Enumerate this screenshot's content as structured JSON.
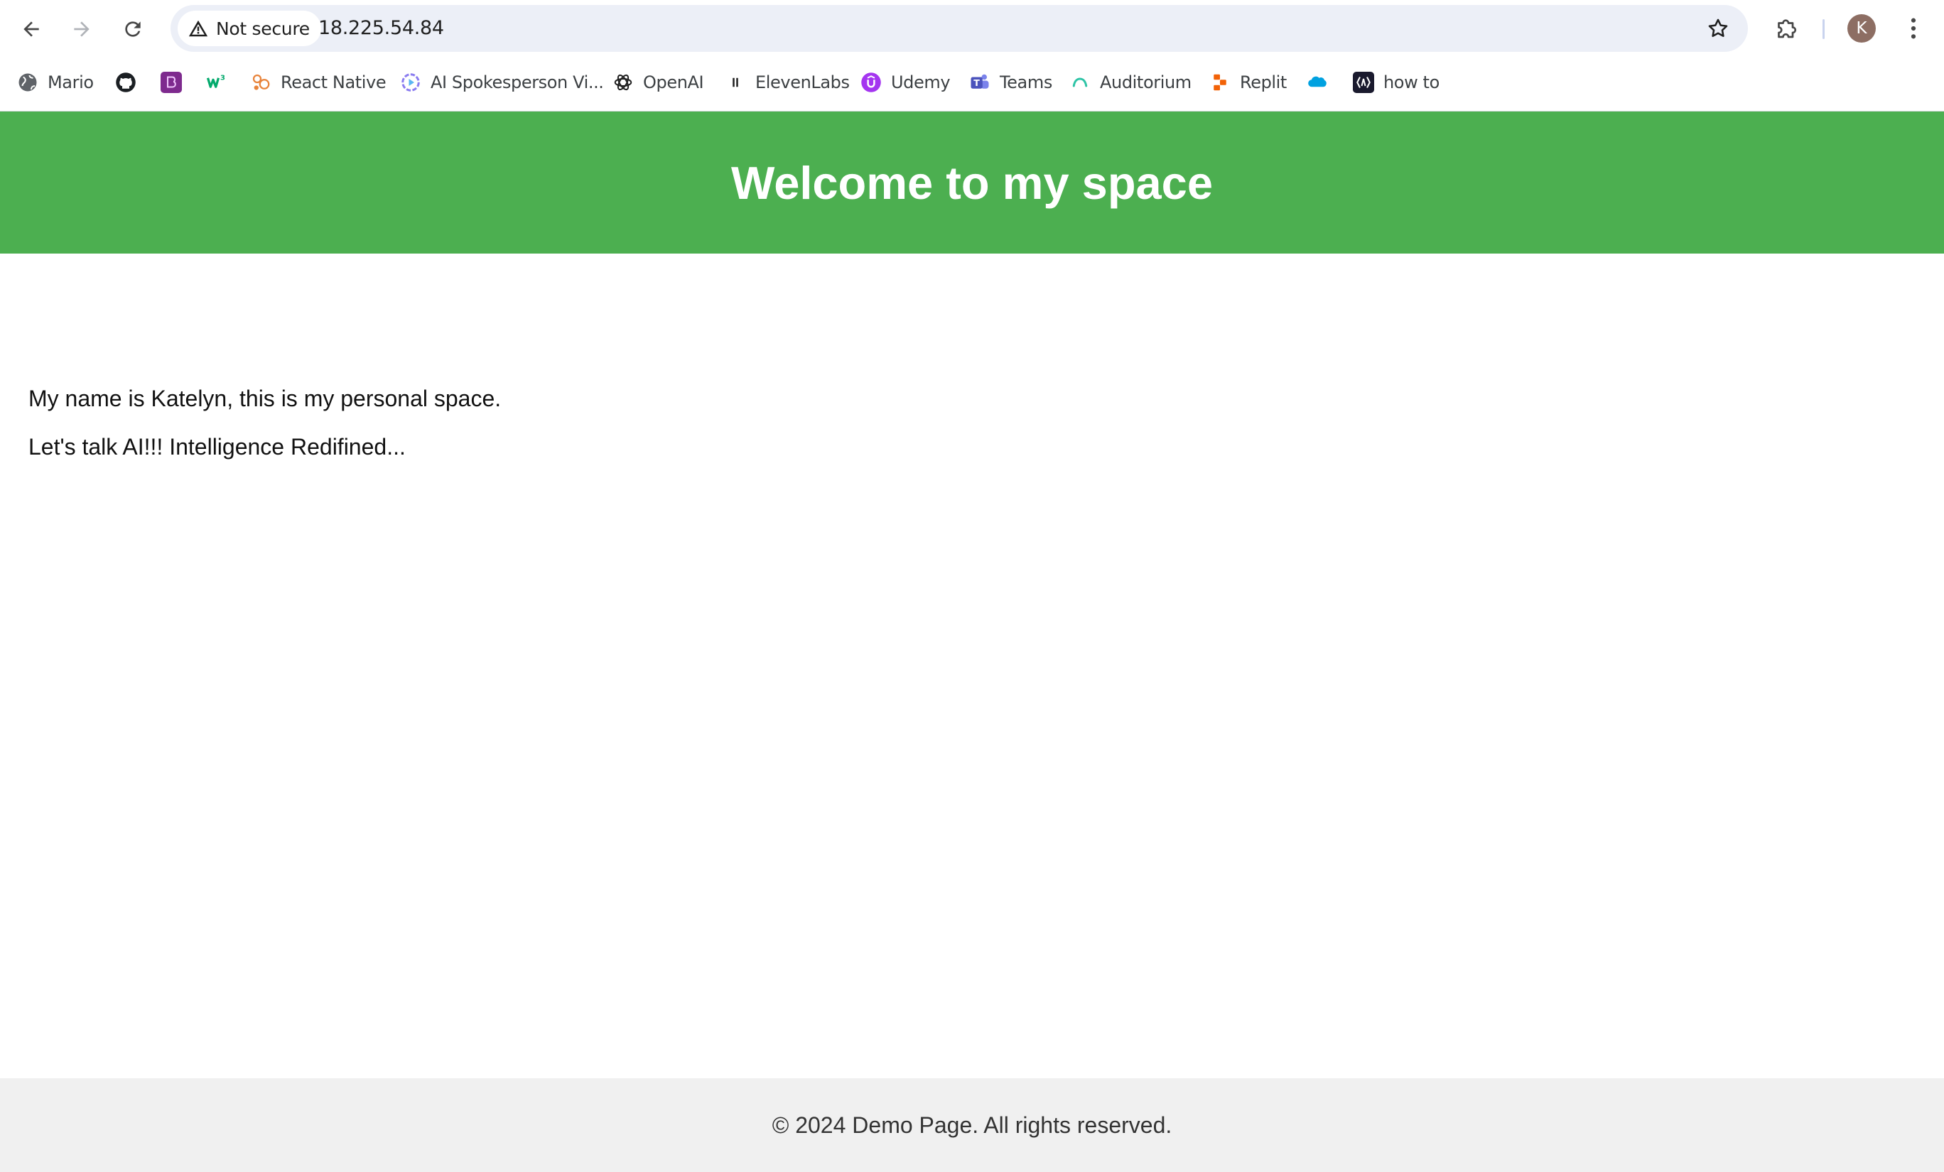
{
  "browser": {
    "security_label": "Not secure",
    "url": "18.225.54.84",
    "profile_initial": "K",
    "icons": {
      "back": "arrow-left-icon",
      "forward": "arrow-right-icon",
      "reload": "reload-icon",
      "security": "warning-triangle-icon",
      "bookmark": "star-icon",
      "extensions": "puzzle-icon",
      "menu": "kebab-menu-icon"
    }
  },
  "bookmarks": [
    {
      "label": "Mario",
      "icon": "globe-icon"
    },
    {
      "label": "",
      "icon": "github-icon"
    },
    {
      "label": "",
      "icon": "bootstrap-icon"
    },
    {
      "label": "",
      "icon": "w3schools-icon"
    },
    {
      "label": "React Native",
      "icon": "react-native-icon"
    },
    {
      "label": "AI Spokesperson Vi...",
      "icon": "ai-spokesperson-icon"
    },
    {
      "label": "OpenAI",
      "icon": "openai-icon"
    },
    {
      "label": "ElevenLabs",
      "icon": "elevenlabs-icon"
    },
    {
      "label": "Udemy",
      "icon": "udemy-icon"
    },
    {
      "label": "Teams",
      "icon": "teams-icon"
    },
    {
      "label": "Auditorium",
      "icon": "auditorium-icon"
    },
    {
      "label": "Replit",
      "icon": "replit-icon"
    },
    {
      "label": "",
      "icon": "salesforce-icon"
    },
    {
      "label": "how to",
      "icon": "how-to-icon"
    }
  ],
  "page": {
    "header_title": "Welcome to my space",
    "intro": "My name is Katelyn, this is my personal space.",
    "tagline": "Let's talk AI!!! Intelligence Redifined...",
    "footer": "© 2024 Demo Page. All rights reserved."
  },
  "colors": {
    "header_bg": "#4caf50",
    "footer_bg": "#f0f0f0",
    "omnibox_bg": "#eceff7",
    "avatar_bg": "#8d6e63"
  }
}
